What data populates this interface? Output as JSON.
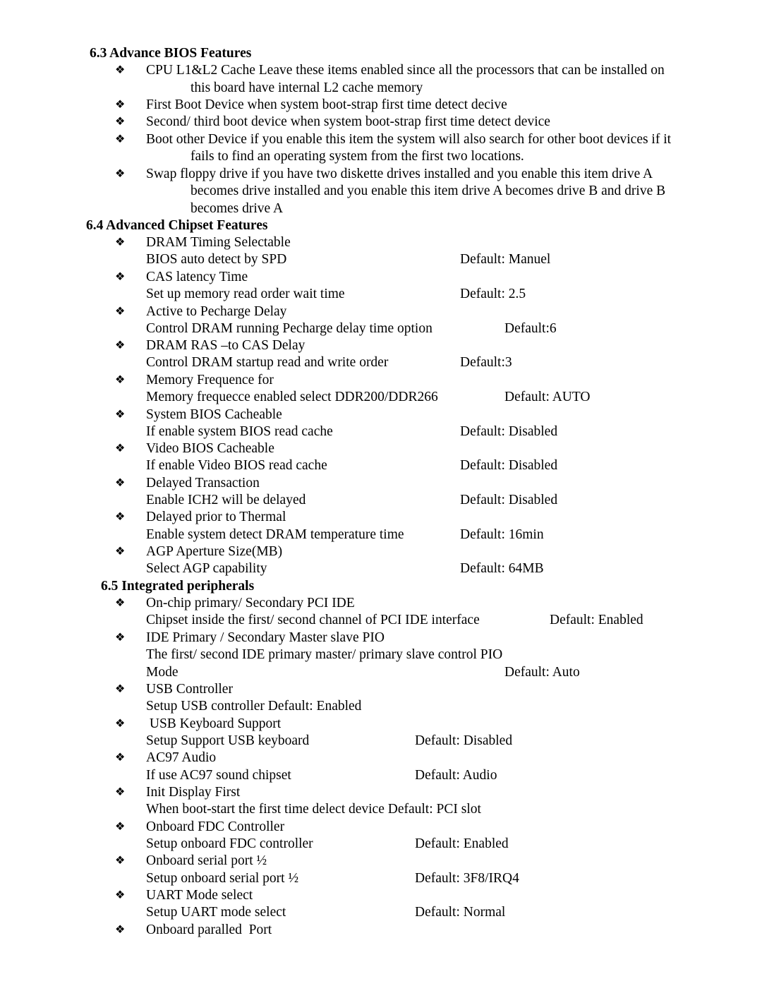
{
  "sections": [
    {
      "heading": "6.3 Advance BIOS Features",
      "items": [
        {
          "lines": [
            "CPU L1&L2 Cache Leave these items enabled  since all the processors that can be installed on",
            "this board have internal L2 cache memory"
          ]
        },
        {
          "lines": [
            "First Boot Device when system boot-strap first time detect decive"
          ]
        },
        {
          "lines": [
            "Second/ third boot device when system boot-strap first time detect device"
          ]
        },
        {
          "lines": [
            "Boot other Device if you enable this item the system will also search for other boot devices if it",
            "fails to find an operating system from the first two locations."
          ]
        },
        {
          "lines": [
            "Swap floppy drive if you have two diskette drives installed and you enable this item drive A",
            "becomes drive installed and you enable this item drive A becomes drive B and drive B",
            "becomes drive A"
          ]
        }
      ]
    },
    {
      "heading": "6.4 Advanced Chipset Features",
      "items": [
        {
          "title": "DRAM Timing Selectable",
          "desc": "BIOS auto detect by SPD",
          "default": "Default: Manuel"
        },
        {
          "title": "CAS latency Time",
          "desc": "Set up memory read order wait time",
          "default": "Default: 2.5"
        },
        {
          "title": "Active to Pecharge Delay",
          "desc": "Control DRAM running Pecharge delay time option",
          "default": "Default:6"
        },
        {
          "title": "DRAM RAS –to CAS  Delay",
          "desc": "Control DRAM startup read and write order",
          "default": "Default:3"
        },
        {
          "title": "Memory Frequence for",
          "desc": "Memory frequecce enabled select DDR200/DDR266",
          "default": "Default: AUTO"
        },
        {
          "title": "System BIOS Cacheable",
          "desc": "If enable system BIOS read cache",
          "default": "Default: Disabled"
        },
        {
          "title": "Video BIOS Cacheable",
          "desc": "If enable Video BIOS read cache",
          "default": "Default: Disabled"
        },
        {
          "title": "Delayed Transaction",
          "desc": "Enable ICH2 will be delayed",
          "default": "Default: Disabled"
        },
        {
          "title": "Delayed prior to Thermal",
          "desc": "Enable system detect DRAM temperature time",
          "default": "Default: 16min"
        },
        {
          "title": "AGP Aperture Size(MB)",
          "desc": "Select AGP capability",
          "default": "Default: 64MB"
        }
      ]
    },
    {
      "heading": "6.5 Integrated peripherals",
      "items": [
        {
          "title": "On-chip primary/ Secondary PCI IDE",
          "desc": "Chipset inside the first/ second channel of PCI IDE interface",
          "default": "Default: Enabled"
        },
        {
          "title": "IDE Primary / Secondary Master slave PIO",
          "desc": "The first/ second IDE primary master/ primary slave control PIO",
          "desc2": "Mode",
          "default": "Default: Auto"
        },
        {
          "title": "USB Controller",
          "desc": "Setup USB controller Default: Enabled"
        },
        {
          "title": " USB Keyboard Support",
          "desc": "Setup Support USB keyboard",
          "default": "Default: Disabled"
        },
        {
          "title": "AC97 Audio",
          "desc": "If use AC97 sound chipset",
          "default": "Default: Audio"
        },
        {
          "title": "Init Display First",
          "desc": "When boot-start the first time delect device Default: PCI slot"
        },
        {
          "title": "Onboard FDC Controller",
          "desc": "Setup onboard FDC controller",
          "default": "Default: Enabled"
        },
        {
          "title": "Onboard serial port ½",
          "desc": "Setup onboard serial port ½",
          "default": "Default: 3F8/IRQ4"
        },
        {
          "title": "UART Mode select",
          "desc": "Setup UART mode select",
          "default": "Default: Normal"
        },
        {
          "title": "Onboard paralled  Port"
        }
      ]
    }
  ],
  "bullet_icon": "❖"
}
